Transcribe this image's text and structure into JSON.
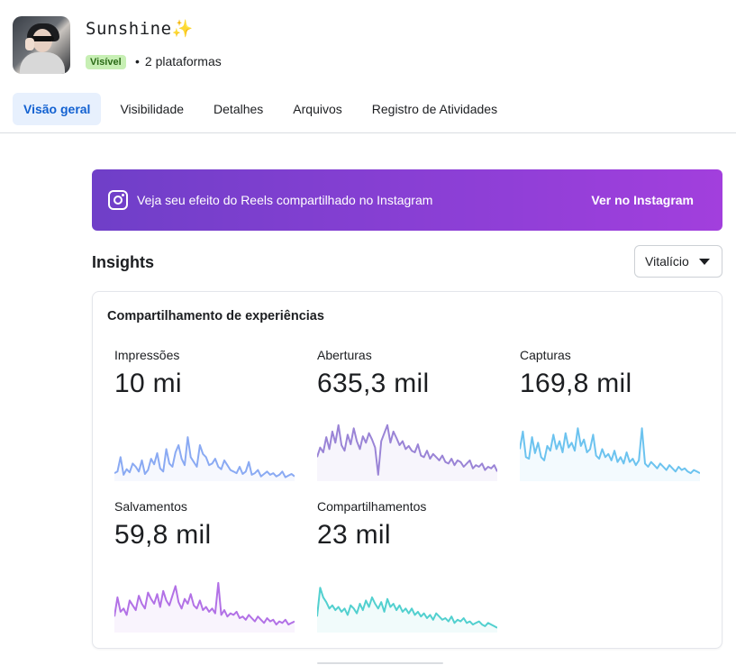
{
  "profile": {
    "name": "Sunshine",
    "sparkle": "✨",
    "status_badge": "Visível",
    "platforms": "2 plataformas"
  },
  "tabs": [
    "Visão geral",
    "Visibilidade",
    "Detalhes",
    "Arquivos",
    "Registro de Atividades"
  ],
  "banner": {
    "text": "Veja seu efeito do Reels compartilhado no Instagram",
    "button": "Ver no Instagram"
  },
  "insights": {
    "title": "Insights",
    "period": "Vitalício"
  },
  "card": {
    "title": "Compartilhamento de experiências",
    "metrics": [
      {
        "label": "Impressões",
        "value": "10 mi",
        "color": "#8aaaf3"
      },
      {
        "label": "Aberturas",
        "value": "635,3 mil",
        "color": "#9a84d6"
      },
      {
        "label": "Capturas",
        "value": "169,8 mil",
        "color": "#6cc3ef"
      },
      {
        "label": "Salvamentos",
        "value": "59,8 mil",
        "color": "#b271e6"
      },
      {
        "label": "Compartilhamentos",
        "value": "23 mil",
        "color": "#52d0cf"
      }
    ]
  },
  "sparklines": [
    [
      10,
      12,
      30,
      8,
      15,
      11,
      22,
      18,
      12,
      26,
      9,
      14,
      28,
      21,
      35,
      16,
      12,
      40,
      22,
      18,
      36,
      45,
      28,
      20,
      55,
      30,
      24,
      18,
      45,
      34,
      30,
      20,
      22,
      28,
      18,
      15,
      26,
      20,
      14,
      12,
      10,
      18,
      9,
      12,
      24,
      8,
      10,
      14,
      6,
      9,
      12,
      8,
      10,
      6,
      8,
      12,
      5,
      7,
      9,
      6
    ],
    [
      30,
      42,
      36,
      55,
      40,
      62,
      48,
      70,
      45,
      38,
      58,
      46,
      66,
      50,
      40,
      56,
      48,
      60,
      52,
      42,
      8,
      50,
      60,
      70,
      48,
      62,
      54,
      45,
      50,
      40,
      44,
      38,
      36,
      46,
      32,
      30,
      38,
      28,
      34,
      30,
      26,
      32,
      24,
      22,
      28,
      20,
      26,
      24,
      18,
      22,
      26,
      16,
      20,
      18,
      22,
      14,
      18,
      16,
      20,
      12
    ],
    [
      40,
      62,
      30,
      28,
      55,
      35,
      48,
      30,
      26,
      44,
      38,
      58,
      40,
      50,
      36,
      60,
      42,
      48,
      38,
      66,
      44,
      52,
      36,
      40,
      58,
      32,
      28,
      40,
      30,
      34,
      26,
      38,
      24,
      30,
      22,
      36,
      24,
      28,
      20,
      26,
      66,
      22,
      18,
      24,
      20,
      16,
      22,
      18,
      14,
      20,
      16,
      12,
      18,
      14,
      16,
      12,
      10,
      14,
      12,
      10
    ],
    [
      20,
      44,
      26,
      30,
      22,
      40,
      34,
      28,
      46,
      36,
      30,
      50,
      42,
      36,
      48,
      32,
      52,
      40,
      34,
      46,
      58,
      38,
      30,
      42,
      36,
      48,
      34,
      30,
      40,
      28,
      32,
      26,
      30,
      24,
      62,
      22,
      28,
      20,
      24,
      22,
      26,
      18,
      20,
      16,
      22,
      18,
      14,
      20,
      16,
      12,
      18,
      14,
      16,
      10,
      14,
      12,
      16,
      10,
      12,
      14
    ],
    [
      20,
      56,
      44,
      38,
      30,
      34,
      28,
      32,
      26,
      30,
      22,
      34,
      30,
      24,
      36,
      28,
      40,
      32,
      44,
      36,
      30,
      38,
      26,
      42,
      32,
      36,
      28,
      34,
      26,
      30,
      24,
      30,
      22,
      26,
      20,
      24,
      18,
      22,
      16,
      24,
      20,
      16,
      18,
      14,
      20,
      12,
      16,
      14,
      18,
      12,
      14,
      10,
      12,
      14,
      10,
      8,
      12,
      10,
      8,
      6
    ]
  ]
}
